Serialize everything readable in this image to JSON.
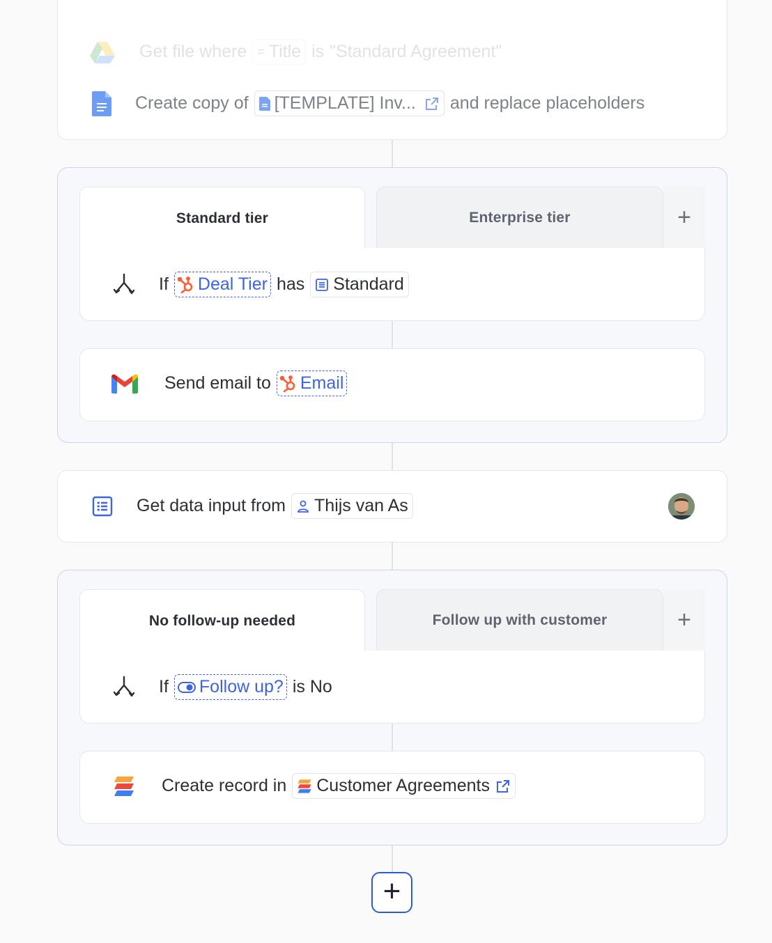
{
  "top_card": {
    "row1": {
      "prefix": "Get file where",
      "field": "Title",
      "op": "is",
      "value": "\"Standard Agreement\""
    },
    "row2": {
      "prefix": "Create copy of",
      "file": "[TEMPLATE] Inv...",
      "suffix": "and replace placeholders"
    }
  },
  "branch_group_1": {
    "tabs": [
      {
        "label": "Standard tier",
        "active": true
      },
      {
        "label": "Enterprise tier",
        "active": false
      }
    ],
    "add_tab": "+",
    "condition": {
      "if": "If",
      "variable": "Deal Tier",
      "op": "has",
      "value": "Standard"
    },
    "action": {
      "prefix": "Send email to",
      "variable": "Email"
    }
  },
  "data_input": {
    "prefix": "Get data input from",
    "person": "Thijs van As"
  },
  "branch_group_2": {
    "tabs": [
      {
        "label": "No follow-up needed",
        "active": true
      },
      {
        "label": "Follow up with customer",
        "active": false
      }
    ],
    "add_tab": "+",
    "condition": {
      "if": "If",
      "variable": "Follow up?",
      "op": "is No"
    },
    "action": {
      "prefix": "Create record in",
      "target": "Customer Agreements"
    }
  },
  "add_step": "+",
  "colors": {
    "accent": "#3d63e6",
    "hubspot": "#ff5c35",
    "group_border": "#c9d4f2"
  }
}
